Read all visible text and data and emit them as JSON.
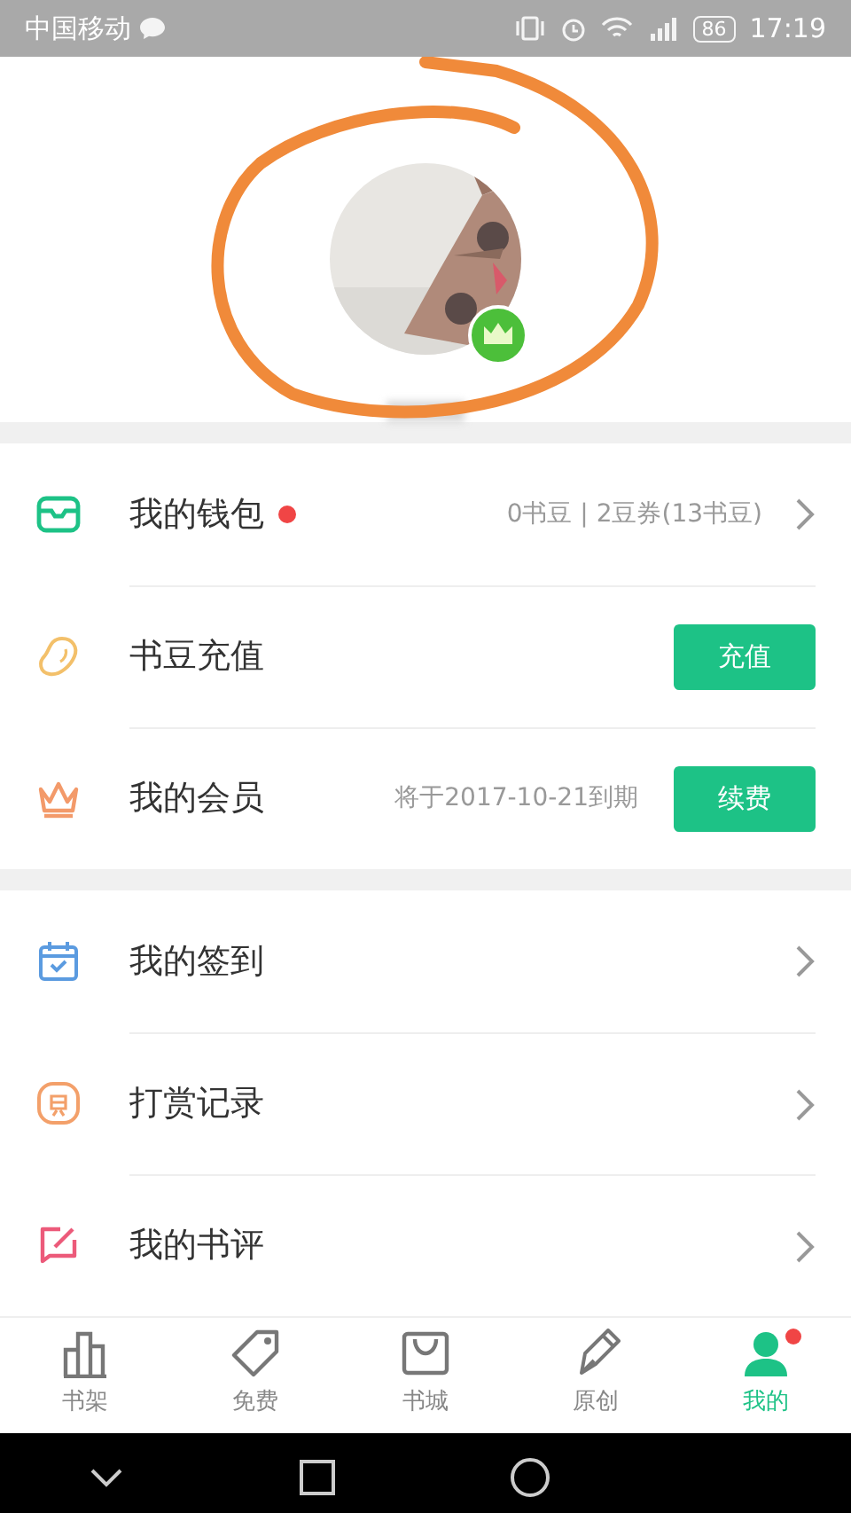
{
  "status_bar": {
    "carrier": "中国移动",
    "battery": "86",
    "time": "17:19"
  },
  "profile": {
    "vip": true,
    "annotated": true
  },
  "menu_groups": [
    [
      {
        "kind": "link",
        "label": "我的钱包",
        "dot": true,
        "detail": "0书豆 | 2豆券(13书豆)"
      },
      {
        "kind": "button",
        "label": "书豆充值",
        "dot": false,
        "button": "充值"
      },
      {
        "kind": "button",
        "label": "我的会员",
        "dot": false,
        "detail": "将于2017-10-21到期",
        "button": "续费"
      }
    ],
    [
      {
        "kind": "link",
        "label": "我的签到",
        "dot": false
      },
      {
        "kind": "link",
        "label": "打赏记录",
        "dot": false
      },
      {
        "kind": "link",
        "label": "我的书评",
        "dot": false
      }
    ]
  ],
  "tabs": [
    {
      "label": "书架",
      "selected": false,
      "dot": false
    },
    {
      "label": "免费",
      "selected": false,
      "dot": false
    },
    {
      "label": "书城",
      "selected": false,
      "dot": false
    },
    {
      "label": "原创",
      "selected": false,
      "dot": false
    },
    {
      "label": "我的",
      "selected": true,
      "dot": true
    }
  ]
}
